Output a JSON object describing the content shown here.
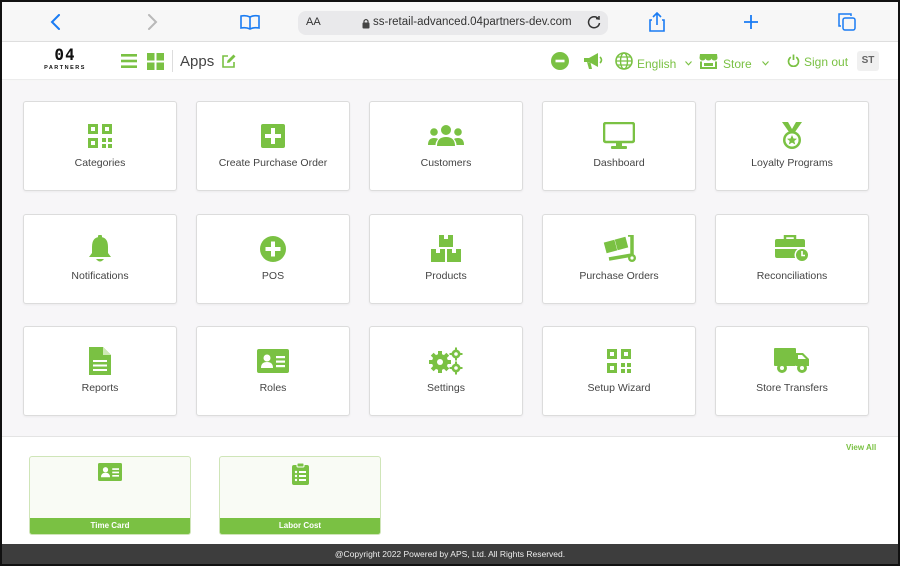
{
  "browser": {
    "text_size_label": "AA",
    "url": "ss-retail-advanced.04partners-dev.com"
  },
  "header": {
    "logo_main": "04",
    "logo_sub": "PARTNERS",
    "title": "Apps",
    "language": "English",
    "store": "Store",
    "sign_out": "Sign out",
    "avatar_initials": "ST"
  },
  "apps": [
    {
      "label": "Categories",
      "icon": "qr-grid-icon"
    },
    {
      "label": "Create Purchase Order",
      "icon": "plus-square-icon"
    },
    {
      "label": "Customers",
      "icon": "users-icon"
    },
    {
      "label": "Dashboard",
      "icon": "monitor-icon"
    },
    {
      "label": "Loyalty Programs",
      "icon": "medal-icon"
    },
    {
      "label": "Notifications",
      "icon": "bell-icon"
    },
    {
      "label": "POS",
      "icon": "plus-circle-icon"
    },
    {
      "label": "Products",
      "icon": "boxes-icon"
    },
    {
      "label": "Purchase Orders",
      "icon": "dolly-icon"
    },
    {
      "label": "Reconciliations",
      "icon": "briefcase-clock-icon"
    },
    {
      "label": "Reports",
      "icon": "document-icon"
    },
    {
      "label": "Roles",
      "icon": "id-card-icon"
    },
    {
      "label": "Settings",
      "icon": "cogs-icon"
    },
    {
      "label": "Setup Wizard",
      "icon": "qr-grid-icon"
    },
    {
      "label": "Store Transfers",
      "icon": "truck-icon"
    }
  ],
  "widgets": {
    "view_all": "View All",
    "items": [
      {
        "label": "Time Card",
        "icon": "id-card-icon"
      },
      {
        "label": "Labor Cost",
        "icon": "clipboard-list-icon"
      }
    ]
  },
  "footer": {
    "copyright": "@Copyright 2022 Powered by APS, Ltd. All Rights Reserved."
  },
  "colors": {
    "accent": "#7ac143",
    "browser_blue": "#1a7cf3",
    "footer_bg": "#3d3d3d"
  }
}
